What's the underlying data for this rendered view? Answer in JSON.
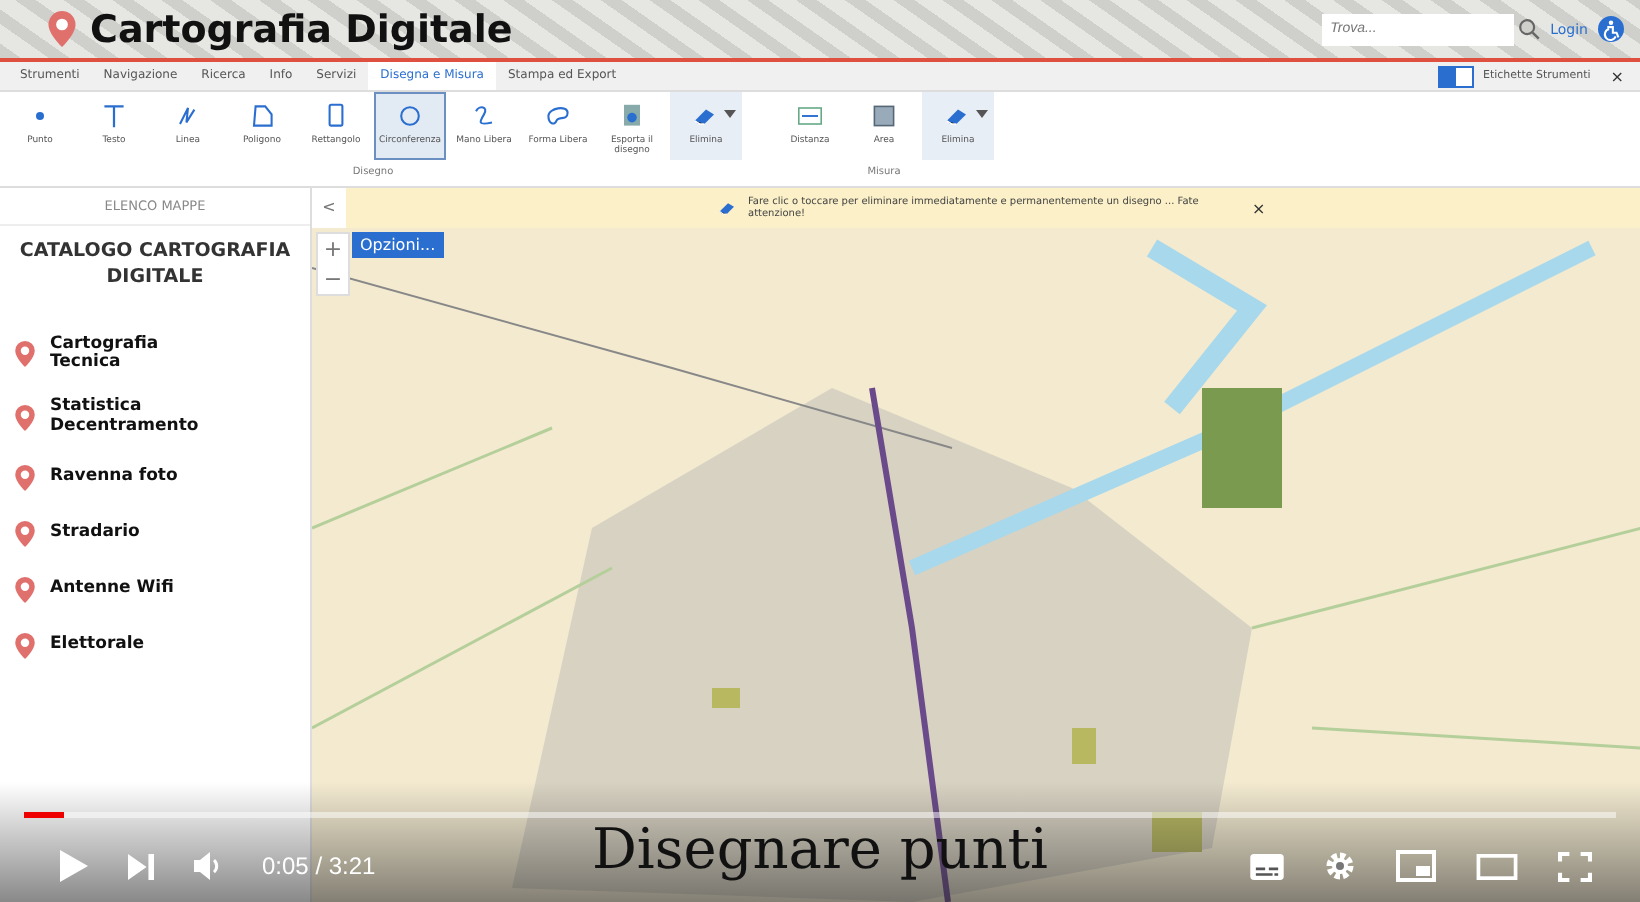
{
  "header": {
    "title": "Cartografia Digitale",
    "search_placeholder": "Trova...",
    "login": "Login"
  },
  "tabs": [
    {
      "label": "Strumenti",
      "selected": false
    },
    {
      "label": "Navigazione",
      "selected": false
    },
    {
      "label": "Ricerca",
      "selected": false
    },
    {
      "label": "Info",
      "selected": false
    },
    {
      "label": "Servizi",
      "selected": false
    },
    {
      "label": "Disegna e Misura",
      "selected": true
    },
    {
      "label": "Stampa ed Export",
      "selected": false
    }
  ],
  "labels_toggle": {
    "label": "Etichette Strumenti",
    "on": true
  },
  "toolbar_close": "×",
  "toolbar_groups": [
    {
      "label": "Disegno",
      "tools": [
        {
          "kind": "point",
          "label": "Punto",
          "selected": false
        },
        {
          "kind": "text",
          "label": "Testo",
          "selected": false
        },
        {
          "kind": "line",
          "label": "Linea",
          "selected": false
        },
        {
          "kind": "polygon",
          "label": "Poligono",
          "selected": false
        },
        {
          "kind": "rectangle",
          "label": "Rettangolo",
          "selected": false
        },
        {
          "kind": "circle",
          "label": "Circonferenza",
          "selected": true
        },
        {
          "kind": "freehand",
          "label": "Mano Libera",
          "selected": false
        },
        {
          "kind": "freeshape",
          "label": "Forma Libera",
          "selected": false
        },
        {
          "kind": "export",
          "label": "Esporta il disegno",
          "selected": false
        },
        {
          "kind": "eraser",
          "label": "Elimina",
          "selected": false
        }
      ]
    },
    {
      "label": "Misura",
      "tools": [
        {
          "kind": "distance",
          "label": "Distanza",
          "selected": false
        },
        {
          "kind": "area",
          "label": "Area",
          "selected": false
        },
        {
          "kind": "eraser",
          "label": "Elimina",
          "selected": false
        }
      ]
    }
  ],
  "sidebar": {
    "header": "ELENCO MAPPE",
    "collapse": "<",
    "title": "CATALOGO CARTOGRAFIA DIGITALE",
    "items": [
      {
        "label": "Cartografia Tecnica"
      },
      {
        "label": "Statistica Decentramento"
      },
      {
        "label": "Ravenna foto"
      },
      {
        "label": "Stradario"
      },
      {
        "label": "Antenne Wifi"
      },
      {
        "label": "Elettorale"
      }
    ]
  },
  "map": {
    "zoom_in": "+",
    "zoom_out": "−",
    "options": "Opzioni...",
    "banner": "Fare clic o toccare per eliminare immediatamente e permanentemente un disegno ... Fate attenzione!",
    "banner_close": "×"
  },
  "video": {
    "caption": "Disegnare punti",
    "time": "0:05 / 3:21",
    "progress": {
      "level": 0.025
    }
  }
}
